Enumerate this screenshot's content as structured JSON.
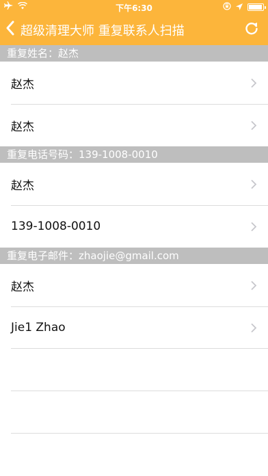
{
  "colors": {
    "accent": "#fcb53b",
    "section_header": "#bebebe",
    "separator": "#dcdcdc",
    "chevron": "#c7c7cc"
  },
  "status_bar": {
    "time": "下午6:30",
    "icons_left": [
      "airplane-icon",
      "wifi-icon"
    ],
    "icons_right": [
      "lock-rotation-icon",
      "location-arrow-icon",
      "battery-icon"
    ]
  },
  "nav": {
    "title": "超级清理大师  重复联系人扫描",
    "back_icon": "chevron-left-icon",
    "refresh_icon": "refresh-icon"
  },
  "sections": [
    {
      "header": "重复姓名：赵杰",
      "rows": [
        "赵杰",
        "赵杰"
      ]
    },
    {
      "header": "重复电话号码：139-1008-0010",
      "rows": [
        "赵杰",
        "139-1008-0010"
      ]
    },
    {
      "header": "重复电子邮件：zhaojie@gmail.com",
      "rows": [
        "赵杰",
        "Jie1 Zhao"
      ]
    }
  ]
}
